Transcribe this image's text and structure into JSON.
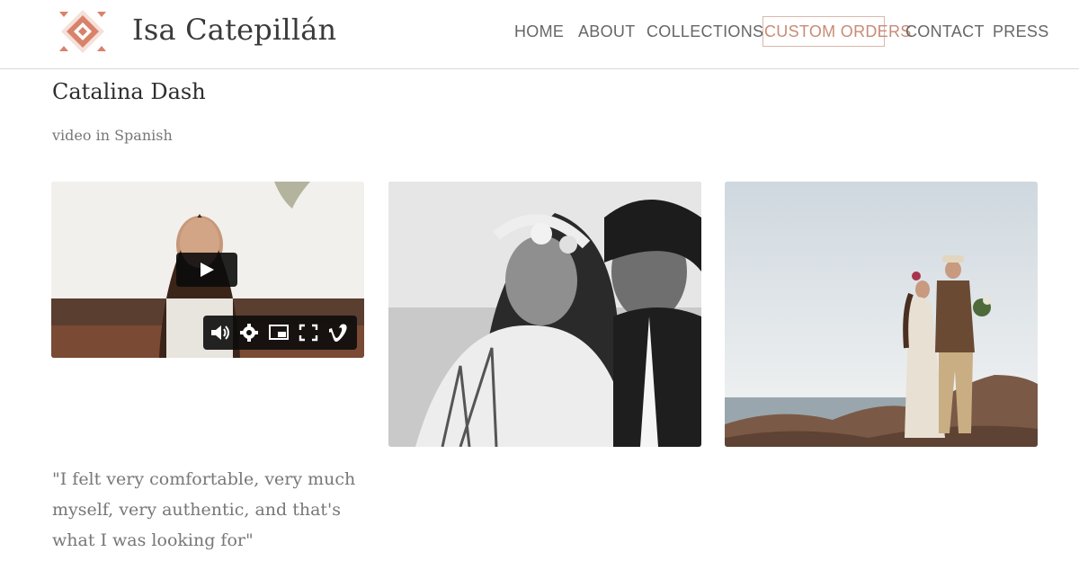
{
  "site": {
    "brand_name": "Isa Catepillán",
    "accent_color": "#c98b76",
    "logo_icon": "aztec-diamond-logo-icon"
  },
  "nav": {
    "items": [
      {
        "label": "HOME"
      },
      {
        "label": "ABOUT"
      },
      {
        "label": "COLLECTIONS"
      },
      {
        "label": "CUSTOM ORDERS",
        "active": true
      },
      {
        "label": "CONTACT"
      },
      {
        "label": "PRESS"
      }
    ]
  },
  "page": {
    "title": "Catalina Dash",
    "subtitle": "video in Spanish",
    "quote": "\"I felt very comfortable, very much myself, very authentic, and that's what I was looking for\""
  },
  "video_player": {
    "play_icon": "play-icon",
    "controls": [
      "volume-icon",
      "settings-gear-icon",
      "picture-in-picture-icon",
      "fullscreen-icon",
      "vimeo-logo-icon"
    ]
  }
}
